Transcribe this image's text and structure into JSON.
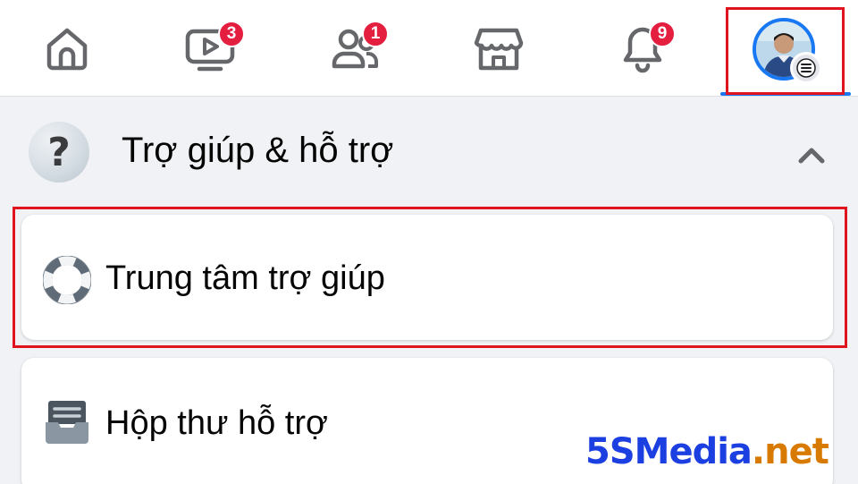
{
  "nav": {
    "badges": {
      "watch": "3",
      "friends": "1",
      "notifications": "9"
    }
  },
  "section": {
    "icon_glyph": "?",
    "title": "Trợ giúp & hỗ trợ"
  },
  "items": [
    {
      "label": "Trung tâm trợ giúp",
      "icon": "lifebuoy-icon"
    },
    {
      "label": "Hộp thư hỗ trợ",
      "icon": "inbox-tray-icon"
    }
  ],
  "watermark": {
    "main": "5SMedia",
    "tld": ".net"
  },
  "colors": {
    "accent": "#1877f2",
    "badge": "#e41e3f",
    "highlight": "#e0141e",
    "watermark_main": "#1b3fe0",
    "watermark_tld": "#d97a00"
  }
}
